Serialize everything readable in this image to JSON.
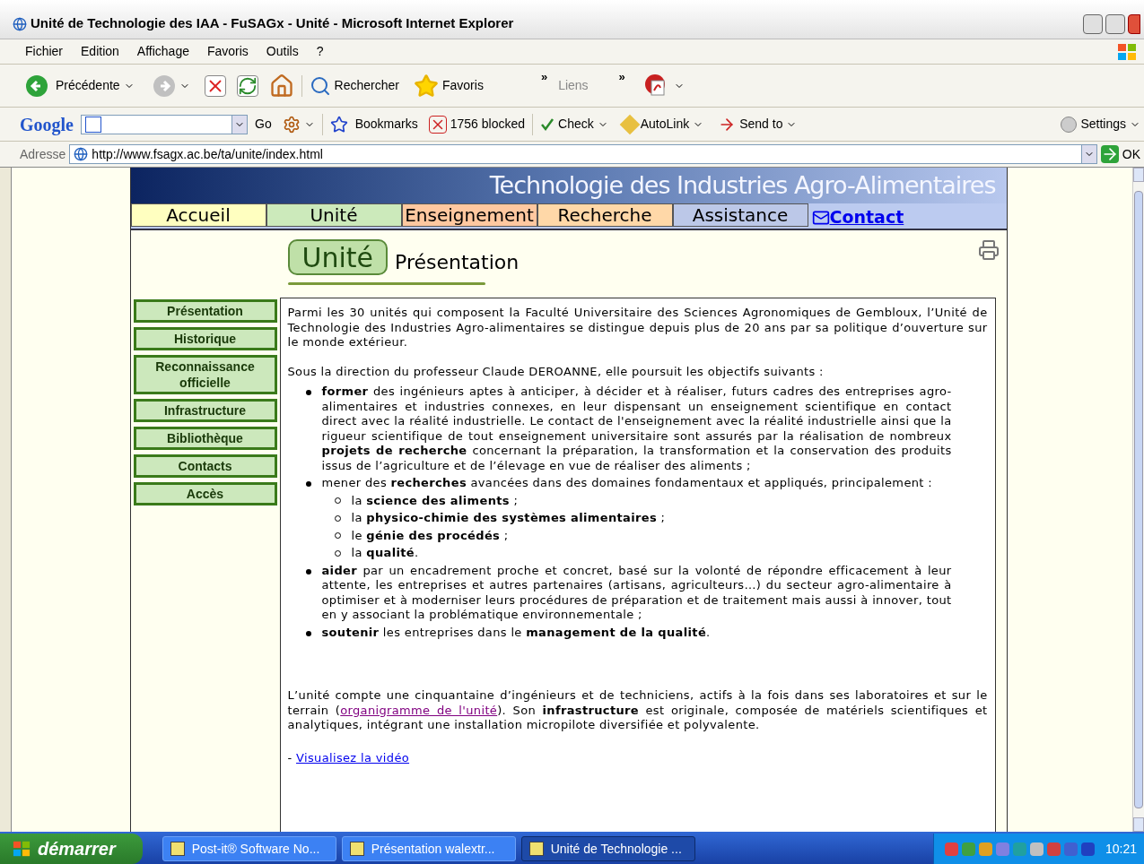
{
  "window": {
    "title": "Unité de Technologie des IAA - FuSAGx - Unité - Microsoft Internet Explorer"
  },
  "menu": [
    "Fichier",
    "Edition",
    "Affichage",
    "Favoris",
    "Outils",
    "?"
  ],
  "toolbar": {
    "back": "Précédente",
    "search": "Rechercher",
    "favorites": "Favoris",
    "chevron_1": "»",
    "links": "Liens",
    "chevron_2": "»"
  },
  "google_bar": {
    "logo": "Google",
    "go": "Go",
    "bookmarks": "Bookmarks",
    "blocked": "1756 blocked",
    "check": "Check",
    "autolink": "AutoLink",
    "send_to": "Send to",
    "settings": "Settings"
  },
  "address_bar": {
    "label": "Adresse",
    "url": "http://www.fsagx.ac.be/ta/unite/index.html",
    "go": "OK"
  },
  "page": {
    "banner_title": "Technologie des Industries Agro-Alimentaires",
    "nav": [
      {
        "label": "Accueil",
        "color": "#ffffc0"
      },
      {
        "label": "Unité",
        "color": "#cceabb"
      },
      {
        "label": "Enseignement",
        "color": "#ffc8a0"
      },
      {
        "label": "Recherche",
        "color": "#ffd8a8"
      },
      {
        "label": "Assistance",
        "color": "#bcc8e8"
      }
    ],
    "contact": "Contact",
    "section": "Unité",
    "heading": "Présentation",
    "sidebar": [
      "Présentation",
      "Historique",
      "Reconnaissance officielle",
      "Infrastructure",
      "Bibliothèque",
      "Contacts",
      "Accès"
    ],
    "intro": "Parmi les 30 unités qui composent la Faculté Universitaire des Sciences Agronomiques de Gembloux, l’Unité de Technologie des Industries Agro-alimentaires se distingue depuis plus de 20 ans par sa politique d’ouverture sur le monde extérieur.",
    "lead": "Sous la direction du professeur Claude DEROANNE, elle poursuit les objectifs suivants :",
    "objectives": [
      {
        "text": "**former** des ingénieurs aptes à anticiper, à décider et à réaliser, futurs cadres des entreprises agro-alimentaires et industries connexes, en leur dispensant un enseignement scientifique en contact direct avec la réalité industrielle. Le contact de l'enseignement avec la réalité industrielle ainsi que la rigueur scientifique de tout enseignement universitaire sont assurés par la réalisation de nombreux **projets de recherche** concernant la préparation, la transformation et la conservation des produits issus de l’agriculture et de l’élevage en vue de réaliser des aliments ;"
      },
      {
        "text": "mener des **recherches** avancées dans des domaines fondamentaux et appliqués, principalement :",
        "children": [
          {
            "text": "la **science des aliments** ;"
          },
          {
            "text": "la **physico-chimie des systèmes alimentaires** ;"
          },
          {
            "text": "le **génie des procédés** ;"
          },
          {
            "text": "la **qualité**."
          }
        ]
      },
      {
        "text": "**aider** par un encadrement proche et concret, basé sur la volonté de répondre efficacement à leur attente, les entreprises et autres partenaires (artisans, agriculteurs…) du secteur agro-alimentaire à optimiser et à moderniser leurs procédures de préparation et de traitement mais aussi à innover, tout en y associant la problématique environnementale ;"
      },
      {
        "text": "**soutenir** les entreprises dans le **management de la qualité**."
      }
    ],
    "staff": {
      "before": "L’unité compte une cinquantaine d’ingénieurs et de techniciens, actifs à la fois dans ses laboratoires et sur le terrain (",
      "link": "organigramme de l'unité",
      "after": "). Son **infrastructure** est originale, composée de matériels scientifiques et analytiques, intégrant une installation micropilote diversifiée et polyvalente."
    },
    "video": {
      "prefix": "- ",
      "link": "Visualisez la vidéo"
    }
  },
  "taskbar": {
    "start": "démarrer",
    "tasks": [
      {
        "label": "Post-it® Software No...",
        "selected": false
      },
      {
        "label": "Présentation walextr...",
        "selected": false
      },
      {
        "label": "Unité de Technologie ...",
        "selected": true
      }
    ],
    "clock": "10:21"
  }
}
